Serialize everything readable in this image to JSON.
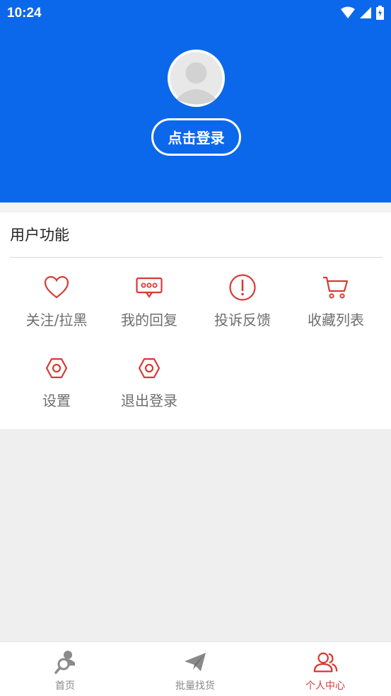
{
  "status_bar": {
    "time": "10:24"
  },
  "header": {
    "login_label": "点击登录"
  },
  "panel": {
    "title": "用户功能",
    "items": [
      {
        "label": "关注/拉黑",
        "icon": "heart-icon"
      },
      {
        "label": "我的回复",
        "icon": "message-icon"
      },
      {
        "label": "投诉反馈",
        "icon": "alert-icon"
      },
      {
        "label": "收藏列表",
        "icon": "cart-icon"
      },
      {
        "label": "设置",
        "icon": "settings-icon"
      },
      {
        "label": "退出登录",
        "icon": "logout-icon"
      }
    ]
  },
  "tabbar": {
    "tabs": [
      {
        "label": "首页",
        "icon": "search-person-icon",
        "active": false
      },
      {
        "label": "批量找货",
        "icon": "paper-plane-icon",
        "active": false
      },
      {
        "label": "个人中心",
        "icon": "users-icon",
        "active": true
      }
    ]
  },
  "colors": {
    "primary": "#0c68ea",
    "accent": "#d83a34",
    "text_muted": "#6e6e6e"
  }
}
